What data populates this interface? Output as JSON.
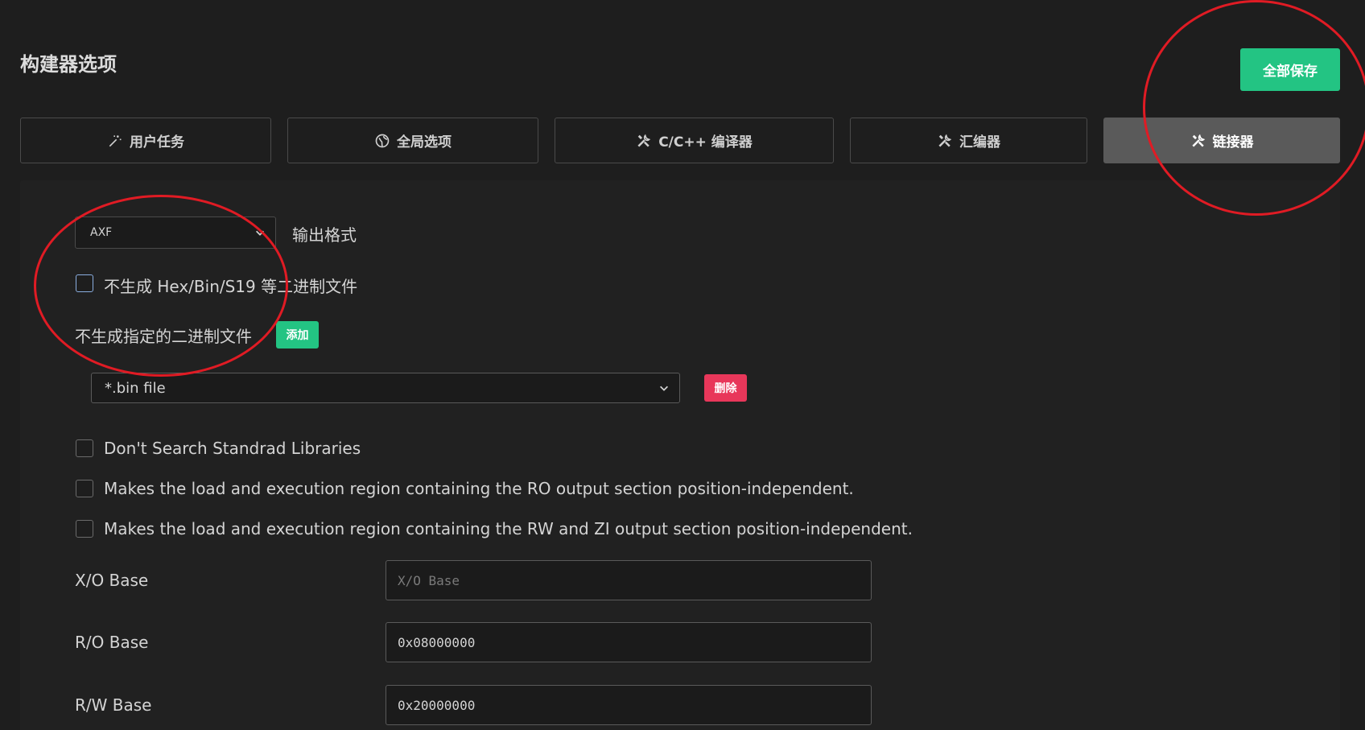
{
  "header": {
    "title": "构建器选项",
    "save_all_label": "全部保存"
  },
  "tabs": [
    {
      "label": "用户任务",
      "icon": "wand-icon"
    },
    {
      "label": "全局选项",
      "icon": "globe-icon"
    },
    {
      "label": "C/C++ 编译器",
      "icon": "tools-icon"
    },
    {
      "label": "汇编器",
      "icon": "tools-icon"
    },
    {
      "label": "链接器",
      "icon": "tools-icon",
      "active": true
    }
  ],
  "linker": {
    "output_format": {
      "value": "AXF",
      "label": "输出格式"
    },
    "no_binary_checkbox": {
      "label": "不生成 Hex/Bin/S19 等二进制文件",
      "checked": false
    },
    "exclude_binary": {
      "label": "不生成指定的二进制文件",
      "add_label": "添加",
      "selected": "*.bin file",
      "delete_label": "删除"
    },
    "options": [
      {
        "label": "Don't Search Standrad Libraries",
        "checked": false
      },
      {
        "label": "Makes the load and execution region containing the RO output section position-independent.",
        "checked": false
      },
      {
        "label": "Makes the load and execution region containing the RW and ZI output section position-independent.",
        "checked": false
      }
    ],
    "fields": [
      {
        "label": "X/O Base",
        "value": "",
        "placeholder": "X/O Base"
      },
      {
        "label": "R/O Base",
        "value": "0x08000000",
        "placeholder": ""
      },
      {
        "label": "R/W Base",
        "value": "0x20000000",
        "placeholder": ""
      }
    ]
  },
  "colors": {
    "save_green": "#23c483",
    "delete_red": "#e8375a",
    "annotation_red": "#e01b24",
    "active_tab": "#5a5a5a"
  }
}
